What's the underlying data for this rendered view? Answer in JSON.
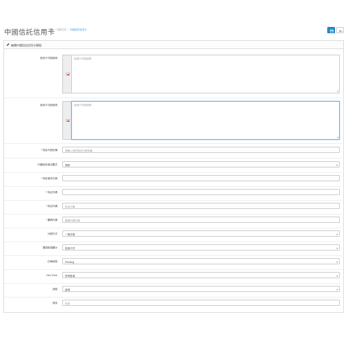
{
  "header": {
    "title": "中國信託信用卡",
    "breadcrumb": [
      "首頁",
      "付款方式",
      "中國信託信用卡"
    ],
    "save_icon": "save-icon",
    "back_icon": "reply-icon"
  },
  "panel": {
    "title": "編輯中國信託信用卡模組"
  },
  "form": {
    "payment_desc": {
      "label": "信用卡付款說明",
      "placeholder": "信用卡付款說明"
    },
    "payment_note": {
      "label": "信用卡付款說明",
      "placeholder": "信用卡付款說明"
    },
    "merchant_id": {
      "label": "特店代號名稱",
      "placeholder": "請輸入您的特店代號名稱",
      "required": true
    },
    "store_mode": {
      "label": "中國信託商店模式",
      "value": "測試",
      "required": false
    },
    "term_id": {
      "label": "特店端末代號",
      "required": true,
      "value": ""
    },
    "key1": {
      "label": "特店代碼",
      "required": true,
      "value": ""
    },
    "key2": {
      "label": "特店代碼",
      "placeholder": "特店代碼",
      "required": true
    },
    "key3": {
      "label": "壓碼代碼",
      "placeholder": "壓碼代碼代碼",
      "required": true
    },
    "installment": {
      "label": "分期方式",
      "value": "一般交易"
    },
    "cart_mode": {
      "label": "選項前端顯示",
      "value": "信用卡付"
    },
    "order_status": {
      "label": "訂單狀態",
      "value": "Pending"
    },
    "geo_zone": {
      "label": "Geo Zone",
      "value": "所有區域"
    },
    "status": {
      "label": "狀態",
      "value": "啟用"
    },
    "sort_order": {
      "label": "排序",
      "placeholder": "排序"
    }
  }
}
